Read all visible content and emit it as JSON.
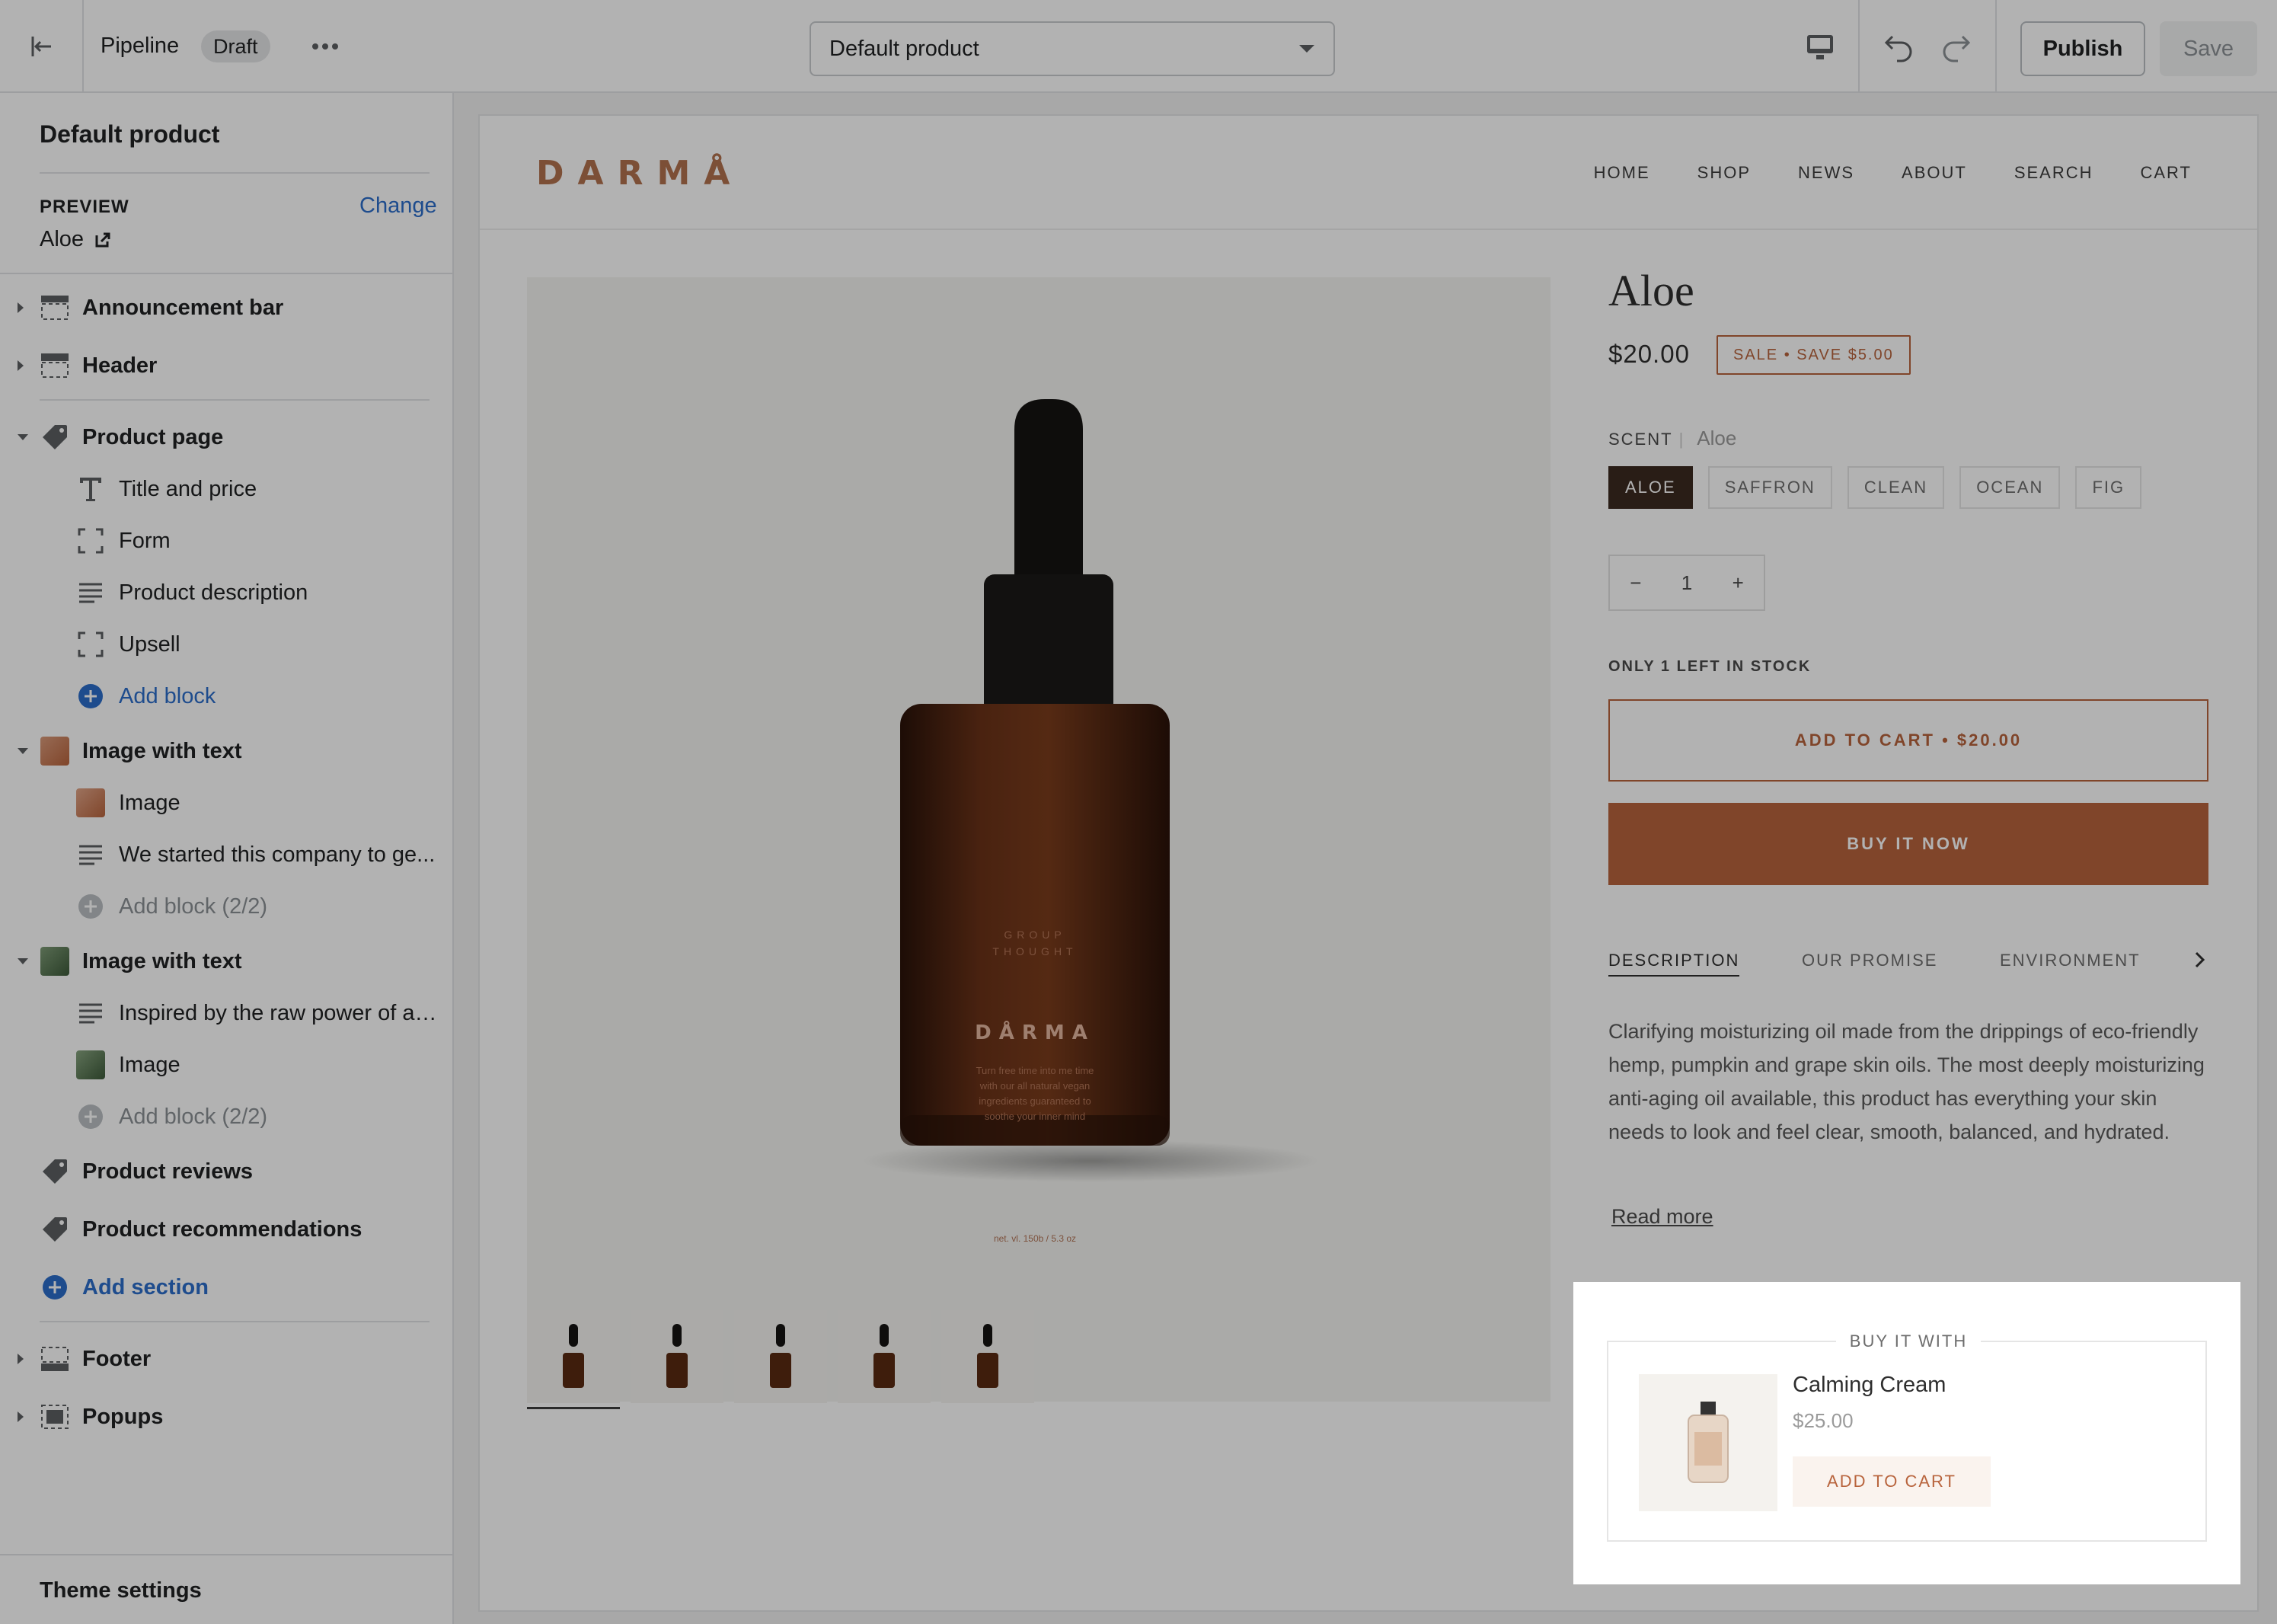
{
  "topbar": {
    "theme_name": "Pipeline",
    "status_badge": "Draft",
    "template_select": "Default product",
    "publish_label": "Publish",
    "save_label": "Save"
  },
  "sidebar": {
    "title": "Default product",
    "preview_label": "PREVIEW",
    "change_label": "Change",
    "preview_value": "Aloe",
    "sections": [
      {
        "label": "Announcement bar"
      },
      {
        "label": "Header"
      },
      {
        "label": "Product page"
      },
      {
        "label": "Image with text"
      },
      {
        "label": "Image with text"
      },
      {
        "label": "Product reviews"
      },
      {
        "label": "Product recommendations"
      },
      {
        "label": "Footer"
      },
      {
        "label": "Popups"
      }
    ],
    "product_blocks": [
      "Title and price",
      "Form",
      "Product description",
      "Upsell"
    ],
    "image_text_1_blocks": [
      "Image",
      "We started this company to ge..."
    ],
    "image_text_2_blocks": [
      "Inspired by the raw power of a ...",
      "Image"
    ],
    "add_block": "Add block",
    "add_block_limited": "Add block (2/2)",
    "add_section": "Add section",
    "theme_settings": "Theme settings",
    "accent_color": "#2c6ecb"
  },
  "store": {
    "logo": "DARMÅ",
    "nav": [
      "HOME",
      "SHOP",
      "NEWS",
      "ABOUT",
      "SEARCH",
      "CART"
    ],
    "bottle_label": {
      "brand_top": "GROUP",
      "brand_sub": "THOUGHT",
      "name": "DÅRMA",
      "tagline_lines": [
        "Turn free time into me time",
        "with our all natural vegan",
        "ingredients guaranteed to",
        "soothe your inner mind"
      ],
      "volume": "net. vl. 150b / 5.3 oz"
    },
    "product": {
      "title": "Aloe",
      "price": "$20.00",
      "sale_badge": "SALE • SAVE $5.00",
      "scent_label": "SCENT",
      "scent_value": "Aloe",
      "scents": [
        "ALOE",
        "SAFFRON",
        "CLEAN",
        "OCEAN",
        "FIG"
      ],
      "quantity": "1",
      "qty_minus": "−",
      "qty_plus": "+",
      "stock_note": "ONLY 1 LEFT IN STOCK",
      "add_to_cart": "ADD TO CART • $20.00",
      "buy_now": "BUY IT NOW",
      "tabs": [
        "DESCRIPTION",
        "OUR PROMISE",
        "ENVIRONMENT"
      ],
      "description": "Clarifying moisturizing oil made from the drippings of eco-friendly hemp, pumpkin and grape skin oils. The most deeply moisturizing anti-aging oil available, this product has everything your skin needs to look and feel clear, smooth, balanced, and hydrated.",
      "read_more": "Read more",
      "brand_color": "#b8643d"
    },
    "upsell": {
      "title": "BUY IT WITH",
      "name": "Calming Cream",
      "price": "$25.00",
      "button": "ADD TO CART"
    }
  }
}
